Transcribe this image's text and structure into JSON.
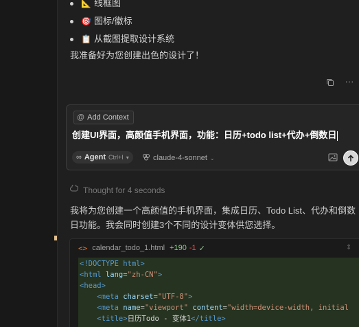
{
  "chat": {
    "bullets": [
      {
        "icon": "📐",
        "icon_name": "ruler-icon",
        "text": "线框图"
      },
      {
        "icon": "🎯",
        "icon_name": "target-icon",
        "text": "图标/徽标"
      },
      {
        "icon": "📋",
        "icon_name": "clipboard-icon",
        "text": "从截图提取设计系统"
      }
    ],
    "ready_text": "我准备好为您创建出色的设计了！"
  },
  "composer": {
    "add_context_label": "Add Context",
    "prompt": "创建UI界面，高颜值手机界面，功能：日历+todo list+代办+倒数日",
    "agent_label": "Agent",
    "agent_shortcut": "Ctrl+I",
    "model": "claude-4-sonnet"
  },
  "response": {
    "thought": "Thought for 4 seconds",
    "line1": "我将为您创建一个高颜值的手机界面，集成日历、Todo List、代办和倒数",
    "line2": "日功能。我会同时创建3个不同的设计变体供您选择。"
  },
  "file": {
    "name": "calendar_todo_1.html",
    "added": "+190",
    "removed": "-1",
    "code_lines": [
      {
        "indent": "",
        "parts": [
          {
            "c": "t-tag",
            "t": "<!DOCTYPE html>"
          }
        ]
      },
      {
        "indent": "",
        "parts": [
          {
            "c": "t-tag",
            "t": "<html"
          },
          {
            "c": "t-attr",
            "t": " lang"
          },
          {
            "c": "t-txt",
            "t": "="
          },
          {
            "c": "t-str",
            "t": "\"zh-CN\""
          },
          {
            "c": "t-tag",
            "t": ">"
          }
        ]
      },
      {
        "indent": "",
        "parts": [
          {
            "c": "t-tag",
            "t": "<head>"
          }
        ]
      },
      {
        "indent": "    ",
        "parts": [
          {
            "c": "t-tag",
            "t": "<meta"
          },
          {
            "c": "t-attr",
            "t": " charset"
          },
          {
            "c": "t-txt",
            "t": "="
          },
          {
            "c": "t-str",
            "t": "\"UTF-8\""
          },
          {
            "c": "t-tag",
            "t": ">"
          }
        ]
      },
      {
        "indent": "    ",
        "parts": [
          {
            "c": "t-tag",
            "t": "<meta"
          },
          {
            "c": "t-attr",
            "t": " name"
          },
          {
            "c": "t-txt",
            "t": "="
          },
          {
            "c": "t-str",
            "t": "\"viewport\""
          },
          {
            "c": "t-attr",
            "t": " content"
          },
          {
            "c": "t-txt",
            "t": "="
          },
          {
            "c": "t-str",
            "t": "\"width=device-width, initial"
          }
        ]
      },
      {
        "indent": "    ",
        "parts": [
          {
            "c": "t-tag",
            "t": "<title>"
          },
          {
            "c": "t-txt",
            "t": "日历Todo - 变体1"
          },
          {
            "c": "t-tag",
            "t": "</title>"
          }
        ]
      }
    ]
  },
  "colors": {
    "background": "#181818",
    "panel": "#1f1f1f",
    "added": "#89d185",
    "removed": "#f14c4c",
    "code_bg": "#263320"
  }
}
